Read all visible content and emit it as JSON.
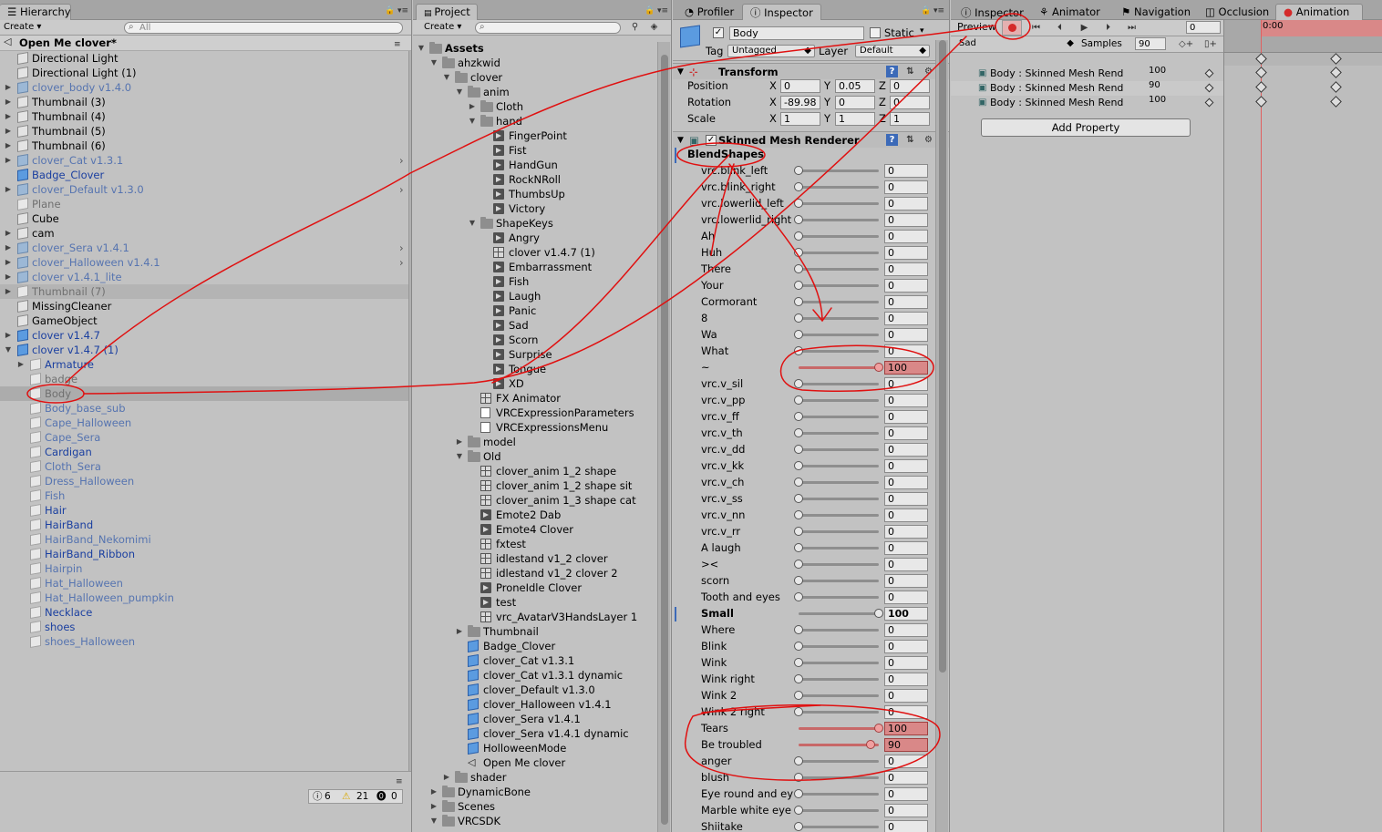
{
  "hierarchy": {
    "tab": "Hierarchy",
    "create": "Create",
    "search_placeholder": "All",
    "scene": "Open Me clover*",
    "items": [
      {
        "label": "Directional Light",
        "color": "black",
        "depth": 0,
        "arrow": false,
        "icon": "cube"
      },
      {
        "label": "Directional Light (1)",
        "color": "black",
        "depth": 0,
        "arrow": false,
        "icon": "cube"
      },
      {
        "label": "clover_body v1.4.0",
        "color": "pblue",
        "depth": 0,
        "arrow": true,
        "icon": "gblue"
      },
      {
        "label": "Thumbnail (3)",
        "color": "black",
        "depth": 0,
        "arrow": true,
        "icon": "cube"
      },
      {
        "label": "Thumbnail (4)",
        "color": "black",
        "depth": 0,
        "arrow": true,
        "icon": "cube"
      },
      {
        "label": "Thumbnail (5)",
        "color": "black",
        "depth": 0,
        "arrow": true,
        "icon": "cube"
      },
      {
        "label": "Thumbnail (6)",
        "color": "black",
        "depth": 0,
        "arrow": true,
        "icon": "cube"
      },
      {
        "label": "clover_Cat v1.3.1",
        "color": "pblue",
        "depth": 0,
        "arrow": true,
        "icon": "gblue",
        "chev": true
      },
      {
        "label": "Badge_Clover",
        "color": "blue",
        "depth": 0,
        "arrow": false,
        "icon": "blue"
      },
      {
        "label": "clover_Default v1.3.0",
        "color": "pblue",
        "depth": 0,
        "arrow": true,
        "icon": "gblue",
        "chev": true
      },
      {
        "label": "Plane",
        "color": "gray",
        "depth": 0,
        "arrow": false,
        "icon": "pale"
      },
      {
        "label": "Cube",
        "color": "black",
        "depth": 0,
        "arrow": false,
        "icon": "cube"
      },
      {
        "label": "cam",
        "color": "black",
        "depth": 0,
        "arrow": true,
        "icon": "cube"
      },
      {
        "label": "clover_Sera v1.4.1",
        "color": "pblue",
        "depth": 0,
        "arrow": true,
        "icon": "gblue",
        "chev": true
      },
      {
        "label": "clover_Halloween v1.4.1",
        "color": "pblue",
        "depth": 0,
        "arrow": true,
        "icon": "gblue",
        "chev": true
      },
      {
        "label": "clover v1.4.1_lite",
        "color": "pblue",
        "depth": 0,
        "arrow": true,
        "icon": "gblue"
      },
      {
        "label": "Thumbnail (7)",
        "color": "gray",
        "depth": 0,
        "arrow": true,
        "icon": "pale",
        "hl": true
      },
      {
        "label": "MissingCleaner",
        "color": "black",
        "depth": 0,
        "arrow": false,
        "icon": "cube"
      },
      {
        "label": "GameObject",
        "color": "black",
        "depth": 0,
        "arrow": false,
        "icon": "cube"
      },
      {
        "label": "clover v1.4.7",
        "color": "blue",
        "depth": 0,
        "arrow": true,
        "icon": "blue"
      },
      {
        "label": "clover v1.4.7 (1)",
        "color": "blue",
        "depth": 0,
        "arrow": true,
        "open": true,
        "icon": "blue"
      },
      {
        "label": "Armature",
        "color": "blue",
        "depth": 1,
        "arrow": true,
        "icon": "pale"
      },
      {
        "label": "badge",
        "color": "gray",
        "depth": 1,
        "arrow": false,
        "icon": "pale"
      },
      {
        "label": "Body",
        "color": "gray",
        "depth": 1,
        "arrow": false,
        "icon": "pale",
        "sel": true
      },
      {
        "label": "Body_base_sub",
        "color": "pblue",
        "depth": 1,
        "arrow": false,
        "icon": "pale"
      },
      {
        "label": "Cape_Halloween",
        "color": "pblue",
        "depth": 1,
        "arrow": false,
        "icon": "pale"
      },
      {
        "label": "Cape_Sera",
        "color": "pblue",
        "depth": 1,
        "arrow": false,
        "icon": "pale"
      },
      {
        "label": "Cardigan",
        "color": "blue",
        "depth": 1,
        "arrow": false,
        "icon": "pale"
      },
      {
        "label": "Cloth_Sera",
        "color": "pblue",
        "depth": 1,
        "arrow": false,
        "icon": "pale"
      },
      {
        "label": "Dress_Halloween",
        "color": "pblue",
        "depth": 1,
        "arrow": false,
        "icon": "pale"
      },
      {
        "label": "Fish",
        "color": "pblue",
        "depth": 1,
        "arrow": false,
        "icon": "pale"
      },
      {
        "label": "Hair",
        "color": "blue",
        "depth": 1,
        "arrow": false,
        "icon": "pale"
      },
      {
        "label": "HairBand",
        "color": "blue",
        "depth": 1,
        "arrow": false,
        "icon": "pale"
      },
      {
        "label": "HairBand_Nekomimi",
        "color": "pblue",
        "depth": 1,
        "arrow": false,
        "icon": "pale"
      },
      {
        "label": "HairBand_Ribbon",
        "color": "blue",
        "depth": 1,
        "arrow": false,
        "icon": "pale"
      },
      {
        "label": "Hairpin",
        "color": "pblue",
        "depth": 1,
        "arrow": false,
        "icon": "pale"
      },
      {
        "label": "Hat_Halloween",
        "color": "pblue",
        "depth": 1,
        "arrow": false,
        "icon": "pale"
      },
      {
        "label": "Hat_Halloween_pumpkin",
        "color": "pblue",
        "depth": 1,
        "arrow": false,
        "icon": "pale"
      },
      {
        "label": "Necklace",
        "color": "blue",
        "depth": 1,
        "arrow": false,
        "icon": "pale"
      },
      {
        "label": "shoes",
        "color": "blue",
        "depth": 1,
        "arrow": false,
        "icon": "pale"
      },
      {
        "label": "shoes_Halloween",
        "color": "pblue",
        "depth": 1,
        "arrow": false,
        "icon": "pale"
      }
    ],
    "console": {
      "logs": "6",
      "warnings": "21",
      "errors": "0"
    }
  },
  "project": {
    "tab": "Project",
    "create": "Create",
    "items": [
      {
        "label": "Assets",
        "depth": 0,
        "type": "folder",
        "arrow": "open",
        "bold": true
      },
      {
        "label": "ahzkwid",
        "depth": 1,
        "type": "folder",
        "arrow": "open"
      },
      {
        "label": "clover",
        "depth": 2,
        "type": "folder",
        "arrow": "open"
      },
      {
        "label": "anim",
        "depth": 3,
        "type": "folder",
        "arrow": "open"
      },
      {
        "label": "Cloth",
        "depth": 4,
        "type": "folder",
        "arrow": "closed"
      },
      {
        "label": "hand",
        "depth": 4,
        "type": "folder",
        "arrow": "open"
      },
      {
        "label": "FingerPoint",
        "depth": 5,
        "type": "anim"
      },
      {
        "label": "Fist",
        "depth": 5,
        "type": "anim"
      },
      {
        "label": "HandGun",
        "depth": 5,
        "type": "anim"
      },
      {
        "label": "RockNRoll",
        "depth": 5,
        "type": "anim"
      },
      {
        "label": "ThumbsUp",
        "depth": 5,
        "type": "anim"
      },
      {
        "label": "Victory",
        "depth": 5,
        "type": "anim"
      },
      {
        "label": "ShapeKeys",
        "depth": 4,
        "type": "folder",
        "arrow": "open"
      },
      {
        "label": "Angry",
        "depth": 5,
        "type": "anim"
      },
      {
        "label": "clover v1.4.7 (1)",
        "depth": 5,
        "type": "grid"
      },
      {
        "label": "Embarrassment",
        "depth": 5,
        "type": "anim"
      },
      {
        "label": "Fish",
        "depth": 5,
        "type": "anim"
      },
      {
        "label": "Laugh",
        "depth": 5,
        "type": "anim"
      },
      {
        "label": "Panic",
        "depth": 5,
        "type": "anim"
      },
      {
        "label": "Sad",
        "depth": 5,
        "type": "anim"
      },
      {
        "label": "Scorn",
        "depth": 5,
        "type": "anim"
      },
      {
        "label": "Surprise",
        "depth": 5,
        "type": "anim"
      },
      {
        "label": "Tongue",
        "depth": 5,
        "type": "anim"
      },
      {
        "label": "XD",
        "depth": 5,
        "type": "anim"
      },
      {
        "label": "FX Animator",
        "depth": 4,
        "type": "grid"
      },
      {
        "label": "VRCExpressionParameters",
        "depth": 4,
        "type": "doc"
      },
      {
        "label": "VRCExpressionsMenu",
        "depth": 4,
        "type": "doc"
      },
      {
        "label": "model",
        "depth": 3,
        "type": "folder",
        "arrow": "closed"
      },
      {
        "label": "Old",
        "depth": 3,
        "type": "folder",
        "arrow": "open"
      },
      {
        "label": "clover_anim 1_2 shape",
        "depth": 4,
        "type": "grid"
      },
      {
        "label": "clover_anim 1_2 shape sit",
        "depth": 4,
        "type": "grid"
      },
      {
        "label": "clover_anim 1_3 shape cat",
        "depth": 4,
        "type": "grid"
      },
      {
        "label": "Emote2 Dab",
        "depth": 4,
        "type": "anim"
      },
      {
        "label": "Emote4 Clover",
        "depth": 4,
        "type": "anim"
      },
      {
        "label": "fxtest",
        "depth": 4,
        "type": "grid"
      },
      {
        "label": "idlestand v1_2 clover",
        "depth": 4,
        "type": "grid"
      },
      {
        "label": "idlestand v1_2 clover 2",
        "depth": 4,
        "type": "grid"
      },
      {
        "label": "ProneIdle Clover",
        "depth": 4,
        "type": "anim"
      },
      {
        "label": "test",
        "depth": 4,
        "type": "anim"
      },
      {
        "label": "vrc_AvatarV3HandsLayer 1",
        "depth": 4,
        "type": "grid"
      },
      {
        "label": "Thumbnail",
        "depth": 3,
        "type": "folder",
        "arrow": "closed"
      },
      {
        "label": "Badge_Clover",
        "depth": 3,
        "type": "prefab"
      },
      {
        "label": "clover_Cat v1.3.1",
        "depth": 3,
        "type": "prefab"
      },
      {
        "label": "clover_Cat v1.3.1 dynamic",
        "depth": 3,
        "type": "prefab"
      },
      {
        "label": "clover_Default v1.3.0",
        "depth": 3,
        "type": "prefab"
      },
      {
        "label": "clover_Halloween v1.4.1",
        "depth": 3,
        "type": "prefab"
      },
      {
        "label": "clover_Sera v1.4.1",
        "depth": 3,
        "type": "prefab"
      },
      {
        "label": "clover_Sera v1.4.1 dynamic",
        "depth": 3,
        "type": "prefab"
      },
      {
        "label": "HolloweenMode",
        "depth": 3,
        "type": "prefab"
      },
      {
        "label": "Open Me clover",
        "depth": 3,
        "type": "unity"
      },
      {
        "label": "shader",
        "depth": 2,
        "type": "folder",
        "arrow": "closed"
      },
      {
        "label": "DynamicBone",
        "depth": 1,
        "type": "folder",
        "arrow": "closed"
      },
      {
        "label": "Scenes",
        "depth": 1,
        "type": "folder",
        "arrow": "closed"
      },
      {
        "label": "VRCSDK",
        "depth": 1,
        "type": "folder",
        "arrow": "open"
      }
    ]
  },
  "inspector": {
    "tabs": {
      "profiler": "Profiler",
      "inspector": "Inspector"
    },
    "object_name": "Body",
    "static_label": "Static",
    "tag_label": "Tag",
    "tag_value": "Untagged",
    "layer_label": "Layer",
    "layer_value": "Default",
    "transform": {
      "title": "Transform",
      "position": {
        "label": "Position",
        "x": "0",
        "y": "0.05",
        "z": "0"
      },
      "rotation": {
        "label": "Rotation",
        "x": "-89.98",
        "y": "0",
        "z": "0"
      },
      "scale": {
        "label": "Scale",
        "x": "1",
        "y": "1",
        "z": "1"
      }
    },
    "smr_title": "Skinned Mesh Renderer",
    "blendshapes_label": "BlendShapes",
    "blendshapes": [
      {
        "name": "vrc.blink_left",
        "value": 0
      },
      {
        "name": "vrc.blink_right",
        "value": 0
      },
      {
        "name": "vrc.lowerlid_left",
        "value": 0
      },
      {
        "name": "vrc.lowerlid_right",
        "value": 0
      },
      {
        "name": "Ah",
        "value": 0
      },
      {
        "name": "Huh",
        "value": 0
      },
      {
        "name": "There",
        "value": 0
      },
      {
        "name": "Your",
        "value": 0
      },
      {
        "name": "Cormorant",
        "value": 0
      },
      {
        "name": "8",
        "value": 0
      },
      {
        "name": "Wa",
        "value": 0
      },
      {
        "name": "What",
        "value": 0
      },
      {
        "name": "~",
        "value": 100,
        "anim": true
      },
      {
        "name": "vrc.v_sil",
        "value": 0
      },
      {
        "name": "vrc.v_pp",
        "value": 0
      },
      {
        "name": "vrc.v_ff",
        "value": 0
      },
      {
        "name": "vrc.v_th",
        "value": 0
      },
      {
        "name": "vrc.v_dd",
        "value": 0
      },
      {
        "name": "vrc.v_kk",
        "value": 0
      },
      {
        "name": "vrc.v_ch",
        "value": 0
      },
      {
        "name": "vrc.v_ss",
        "value": 0
      },
      {
        "name": "vrc.v_nn",
        "value": 0
      },
      {
        "name": "vrc.v_rr",
        "value": 0
      },
      {
        "name": "A laugh",
        "value": 0
      },
      {
        "name": "><",
        "value": 0
      },
      {
        "name": "scorn",
        "value": 0
      },
      {
        "name": "Tooth and eyes",
        "value": 0
      },
      {
        "name": "Small",
        "value": 100,
        "bold": true
      },
      {
        "name": "Where",
        "value": 0
      },
      {
        "name": "Blink",
        "value": 0
      },
      {
        "name": "Wink",
        "value": 0
      },
      {
        "name": "Wink right",
        "value": 0
      },
      {
        "name": "Wink 2",
        "value": 0
      },
      {
        "name": "Wink 2 right",
        "value": 0
      },
      {
        "name": "Tears",
        "value": 100,
        "anim": true
      },
      {
        "name": "Be troubled",
        "value": 90,
        "anim": true
      },
      {
        "name": "anger",
        "value": 0
      },
      {
        "name": "blush",
        "value": 0
      },
      {
        "name": "Eye round and ey",
        "value": 0
      },
      {
        "name": "Marble white eye",
        "value": 0
      },
      {
        "name": "Shiitake",
        "value": 0
      }
    ]
  },
  "animation": {
    "tabs": {
      "inspector": "Inspector",
      "animator": "Animator",
      "navigation": "Navigation",
      "occlusion": "Occlusion",
      "animation": "Animation"
    },
    "preview_label": "Preview",
    "frame": "0",
    "clip": "Sad",
    "samples_label": "Samples",
    "samples": "90",
    "time": "0:00",
    "properties": [
      {
        "label": "Body : Skinned Mesh Rend",
        "value": "100"
      },
      {
        "label": "Body : Skinned Mesh Rend",
        "value": "90"
      },
      {
        "label": "Body : Skinned Mesh Rend",
        "value": "100"
      }
    ],
    "add_property": "Add Property",
    "record_color": "#d42a2a"
  }
}
